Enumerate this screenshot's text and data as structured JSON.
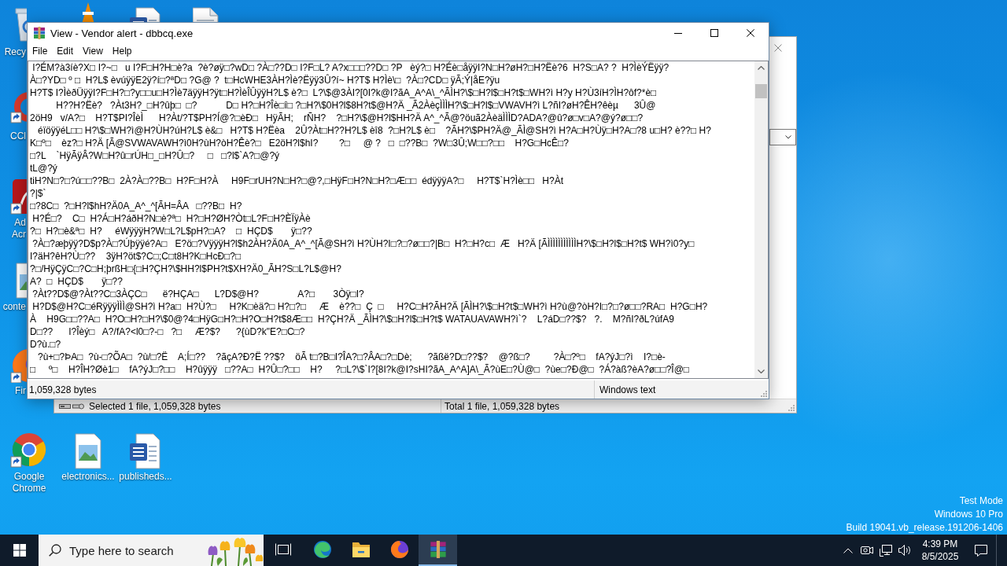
{
  "desktop": {
    "icons": [
      {
        "kind": "bin",
        "label": [
          "Recy"
        ]
      },
      {
        "kind": "cone"
      },
      {
        "kind": "worddoc"
      },
      {
        "kind": "page"
      },
      {
        "kind": "ring",
        "shortcut": true,
        "label": [
          "CCl"
        ]
      },
      {
        "kind": "tile",
        "shortcut": true,
        "label": [
          "Ad",
          "Acr"
        ]
      },
      {
        "kind": "image",
        "shortcut": false,
        "label": [
          "conte"
        ]
      },
      {
        "kind": "fox",
        "shortcut": true,
        "label": [
          "Fir"
        ]
      },
      {
        "kind": "globe",
        "shortcut": true,
        "label": [
          "Google",
          "Chrome"
        ]
      },
      {
        "kind": "image",
        "shortcut": false,
        "label": [
          "electronics..."
        ]
      },
      {
        "kind": "worddoc",
        "shortcut": false,
        "label": [
          "publisheds..."
        ]
      }
    ],
    "system_text": [
      "Test Mode",
      "Windows 10 Pro",
      "Build 19041.vb_release.191206-1406"
    ]
  },
  "background_window": {
    "status_bar": [
      "Selected 1 file, 1,059,328 bytes",
      "Total 1 file, 1,059,328 bytes"
    ]
  },
  "viewer_window": {
    "title": "View - Vendor alert - dbbcq.exe",
    "menu": [
      "File",
      "Edit",
      "View",
      "Help"
    ],
    "lines": [
      " I?ÉM?à3íè?X□ I?~□   u I?F□H?H□è?a  ?è?øÿ□?wD□ ?À□??D□ I?F□L? A?x□□□??D□ ?P   èý?□ H?Éè□åÿÿI?N□H?øH?□H?Ëè?6  H?S□A? ?  H?ÌèÝËÿÿ?",
      "À□?YD□ º □  H?L$ èvúÿÿE2ÿ?í□?ªD□ ?G@ ?  t□HcWHE3ÀH?Ìè?Ëÿÿ3Û?í~ H?T$ H?Ìè\\□  ?À□?CD□ ÿÃ;Ý|åE?ÿu",
      "H?T$ I?ÌèðÜÿÿI?F□H?□?y□□u□H?Ìè7äÿÿH?ÿt□H?ÌèÎÛÿÿH?L$ è?□  L?\\$@3ÀI?[0I?k@I?ãA_A^A\\_^ÃÌH?\\$□H?l$□H?t$□WH?ì H?y H?Ù3íH?ÌH?ôf?*è□",
      "          H??H?Ëè?   ?Àt3H?_□H?ûþ□  □?           D□ H?□H?Îè□î□ ?□H?\\$0H?l$8H?t$@H?Ä _Ã2ÀèçÌÌÌH?\\$□H?l$□VWAVH?ì L?ñI?øH?ÊH?êèµ      3Û@",
      "2öH9   v/A?□    H?T$PI?ÎèÌ      H?Àt/?T$PH?Í@?□èÐ□   HÿÃH;    rÑH?    ?□H?\\$@H?l$HH?Ä A^_^Ã@?öuã2ÀèäÌÌÌD?ADA?@û?ø□v□A?@ý?ø□□?",
      "   éïöÿÿéL□□ H?\\$□WH?ì@H?ÙH?úH?L$ è&□   H?T$ H?Ëèa    2Û?Àt□H??H?L$ èî8  ?□H?L$ è□    ?ÃH?\\$PH?Ä@_ÃÌ@SH?ì H?A□H?Ùÿ□H?A□?8 u□H? è??□ H?",
      "K□º□    èz?□ H?Ä [Ã@SVWAVAWH?ì0H?ùH?òH?Êè?□   E2öH?l$hI?        ?□     @ ?   □  □??B□  ?W□3Û;W□□?□□    H?G□HcÊ□?",
      "□?L    `HÿÃÿÂ?W□H?û□rÚH□_□H?Û□?     □   □?l$`A?□@?ý",
      "tL@?ý",
      "tiH?N□?□?ú□□??B□  2À?À□??B□  H?F□H?À     H9F□rUH?N□H?□@?,□HÿF□H?N□H?□Æ□□  édÿÿÿA?□     H?T$`H?Ìè□□   H?Àt",
      "?|$`",
      "□?8C□  ?□H?l$hH?Ä0A_A^_^[ÃH=ÂA   □??B□  H?",
      " H?É□?    C□  H?Á□H?áðH?N□è?ª□  H?□H?ØH?Òt□L?F□H?ÈÏÿÀè",
      "?□  H?□è&ª□  H?     éWÿÿÿH?W□L?L$pH?□A?    □  HÇD$       ÿ□??",
      " ?À□?æþÿÿ?D$p?À□?Úþÿÿé?A□   E?ö□?VÿÿÿH?l$h2ÀH?Ä0A_A^_^[Ã@SH?ì H?ÙH?I□?□?ø□□?|B□  H?□H?c□  Æ   H?Ä [ÃÌÌÌÌÌÌÌÌÌÌÌH?\\$□H?l$□H?t$ WH?ì0?y□",
      "I?äH?êH?Ù□??    3ÿH?öt$?C□;C□t8H?K□HcÐ□?□",
      "?□/HÿÇÿC□?C□H;þrßH□{□H?ÇH?\\$HH?l$PH?t$XH?Ä0_ÃH?S□L?L$@H?",
      "A?  □  HÇD$       ÿ□??",
      " ?Àt??D$@?Àt??C□3ÀÇC□      ë?HÇA□      L?D$@H?               A?□       3Òÿ□I?",
      " H?D$@H?C□éRÿÿÿÌÌÌ@SH?ì H?a□  H?Ù?□     H?K□èä?□ H?□?□     Æ    è??□  Ç  □     H?C□H?ÃH?Ä [ÃÌH?\\$□H?t$□WH?ì H?ù@?òH?I□?□?ø□□?RA□  H?G□H?",
      "À    H9G□□??A□  H?O□H?□H?\\$0@?4□HÿG□H?□H?O□H?t$8Æ□□  H?ÇH?Ä _ÃÌH?\\$□H?l$□H?t$ WATAUAVAWH?ì`?    L?áD□??$?   ?.    M?ñI?ðL?úfA9",
      "D□??      I?Îèý□   A?/fA?<l0□?-□   ?□     Æ?$?      ?{ùD?k\"E?□C□?",
      "D?ù.□?",
      "   ?ù+□?ÞA□  ?ù-□?ÕA□  ?ù/□?Ë    A;Í□??    ?ãçA?Ð?Ë ??$?    öÃ t□?B□I?ÎA?□?ÂA□?□Dè;      ?ãßë?D□??$?    @?ß□?         ?À□?º□    fA?ýJ□?ì    I?□è-",
      "□     º□    H?ÎH?Øè1□    fA?ýJ□?□□    H?ûÿÿÿ   □??A□  H?Û□?□□    H?     ?□L?\\$`I?[8I?k@I?sHI?ãA_A^A]A\\_Ã?ùE□?Ù@□  ?ùe□?Ð@□  ?Á?àß?èA?ø□□?Î@□"
    ],
    "status_bar": [
      "1,059,328 bytes",
      "Windows text"
    ]
  },
  "taskbar": {
    "search": {
      "placeholder": "Type here to search"
    },
    "apps": [
      {
        "kind": "taskview",
        "selected": false
      },
      {
        "kind": "edge",
        "selected": false
      },
      {
        "kind": "folder",
        "selected": false
      },
      {
        "kind": "fox",
        "selected": false
      },
      {
        "kind": "books",
        "selected": true
      }
    ],
    "clock": {
      "time": "4:39 PM",
      "date": "8/5/2025"
    }
  }
}
